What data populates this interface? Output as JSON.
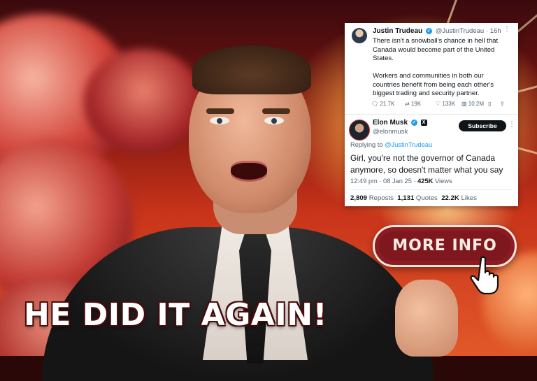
{
  "tweet1": {
    "name": "Justin Trudeau",
    "handle": "@JustinTrudeau",
    "time": "· 16h",
    "text_p1": "There isn't a snowball's chance in hell that Canada would become part of the United States.",
    "text_p2": "Workers and communities in both our countries benefit from being each other's biggest trading and security partner.",
    "metrics": {
      "replies": "21.7K",
      "reposts": "19K",
      "likes": "133K",
      "views": "10.2M"
    }
  },
  "tweet2": {
    "name": "Elon Musk",
    "handle": "@elonmusk",
    "subscribe_label": "Subscribe",
    "replying_prefix": "Replying to",
    "replying_handle": "@JustinTrudeau",
    "text": "Girl, you're not the governor of Canada anymore, so doesn't matter what you say",
    "timestamp": "12:49 pm · 08 Jan 25 ·",
    "views_count": "425K",
    "views_label": "Views",
    "reposts_count": "2,809",
    "reposts_label": "Reposts",
    "quotes_count": "1,131",
    "quotes_label": "Quotes",
    "likes_count": "22.2K",
    "likes_label": "Likes"
  },
  "button": {
    "label": "MORE INFO"
  },
  "headline": "HE DID IT AGAIN!",
  "icons": [
    "reply-icon",
    "repost-icon",
    "like-icon",
    "views-icon",
    "bookmark-icon",
    "share-icon",
    "verified-icon",
    "x-badge-icon",
    "hand-cursor-icon"
  ],
  "colors": {
    "button_bg": "#8a1c22",
    "verified": "#1d9bf0",
    "headline_outline": "#4a0b0b"
  }
}
